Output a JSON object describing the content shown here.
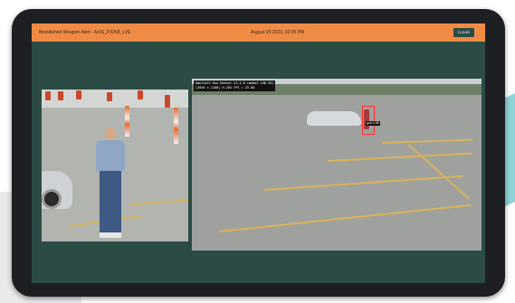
{
  "alert": {
    "title": "Brandished Weapon Alert - AXIS_P3268_LVE",
    "datetime": "August 09 2023, 02:00 PM",
    "clear_label": "CLEAR"
  },
  "feeds": {
    "right": {
      "overlay_line1": "Omnilert Gun Detect v1.2.6 (model v36.33)",
      "overlay_line2": "[3840 x 2160] H.264 FPS = 25.00",
      "detection_label": "gun 0.98"
    }
  },
  "colors": {
    "alert_bar": "#ef8b45",
    "screen_bg": "#2d4b45",
    "bezel": "#1e1f22",
    "detection_box": "#ff2a2a"
  }
}
